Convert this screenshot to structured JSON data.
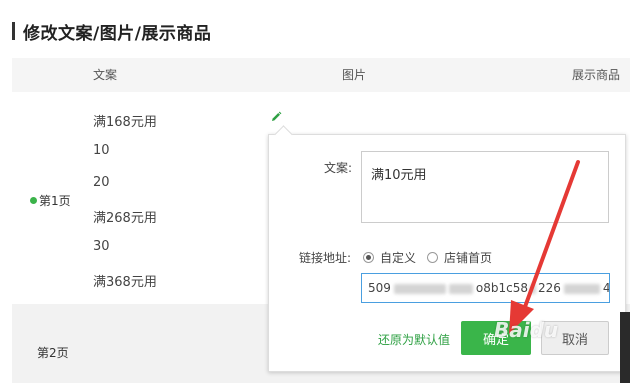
{
  "heading": "修改文案/图片/展示商品",
  "table": {
    "columns": [
      "文案",
      "图片",
      "展示商品"
    ]
  },
  "rows": [
    {
      "page": "第1页",
      "copies": [
        "满168元用",
        "10",
        "20",
        "满268元用",
        "30",
        "满368元用"
      ]
    },
    {
      "page": "第2页"
    }
  ],
  "popup": {
    "copy_label": "文案:",
    "copy_value": "满10元用",
    "link_label": "链接地址:",
    "radio_custom": "自定义",
    "radio_home": "店铺首页",
    "url_prefix": "509",
    "url_middle": "o8b1c58",
    "url_middle2": "226",
    "url_suffix": "4",
    "restore_label": "还原为默认值",
    "ok_label": "确定",
    "cancel_label": "取消"
  },
  "watermark": "Baidu",
  "colors": {
    "accent_green": "#3ab54a",
    "arrow_red": "#e53935",
    "input_focus_blue": "#4a9fe0"
  }
}
